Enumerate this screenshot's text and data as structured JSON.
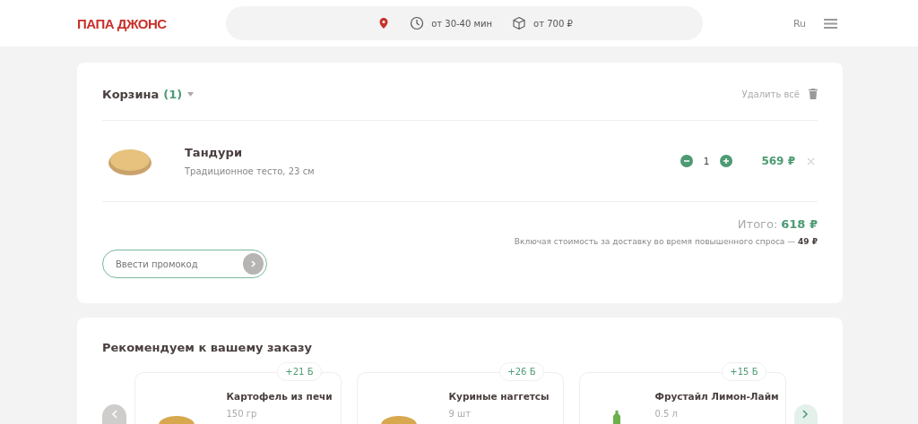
{
  "header": {
    "logo": "ПАПА ДЖОНС",
    "delivery_time": "от 30-40 мин",
    "min_order": "от 700 ₽",
    "language": "Ru"
  },
  "cart": {
    "title": "Корзина",
    "count": "(1)",
    "clear_all": "Удалить всё",
    "items": [
      {
        "name": "Тандури",
        "details": "Традиционное тесто, 23 см",
        "quantity": "1",
        "price": "569 ₽"
      }
    ],
    "total_label": "Итого:",
    "total_value": "618 ₽",
    "delivery_note": "Включая стоимость за доставку во время повышенного спроса — **49 ₽**",
    "promo": {
      "placeholder": "Ввести промокод"
    }
  },
  "recommendations": {
    "title": "Рекомендуем к вашему заказу",
    "prev": {
      "disabled": true
    },
    "next": {
      "disabled": false
    },
    "items": [
      {
        "name": "Картофель из печи",
        "size": "150 гр",
        "bonus": "+21 Б",
        "kind": "food"
      },
      {
        "name": "Куриные наггетсы",
        "size": "9 шт",
        "bonus": "+26 Б",
        "kind": "food"
      },
      {
        "name": "Фрустайл Лимон-Лайм",
        "size": "0.5 л",
        "bonus": "+15 Б",
        "kind": "drink"
      }
    ]
  }
}
